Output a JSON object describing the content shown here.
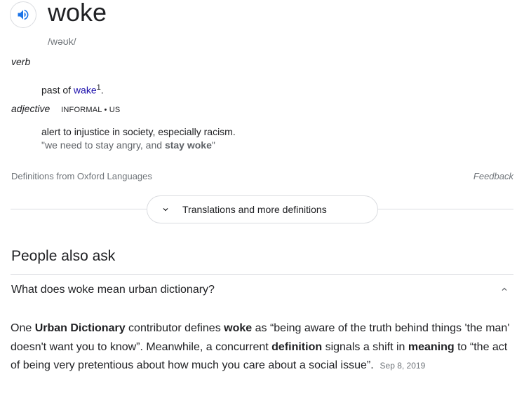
{
  "dictionary": {
    "word": "woke",
    "phonetic": "/wəʊk/",
    "senses": [
      {
        "pos": "verb",
        "definition_prefix": "past of ",
        "link_text": "wake",
        "superscript": "1",
        "definition_suffix": "."
      },
      {
        "pos": "adjective",
        "tag": "INFORMAL • US",
        "definition": "alert to injustice in society, especially racism.",
        "example_prefix": "\"we need to stay angry, and ",
        "example_bold": "stay woke",
        "example_suffix": "\""
      }
    ],
    "source": "Definitions from Oxford Languages",
    "feedback": "Feedback",
    "more_button": "Translations and more definitions"
  },
  "people_also_ask": {
    "title": "People also ask",
    "question": "What does woke mean urban dictionary?",
    "answer": {
      "p1": "One ",
      "b1": "Urban Dictionary",
      "p2": " contributor defines ",
      "b2": "woke",
      "p3": " as “being aware of the truth behind things 'the man' doesn't want you to know”. Meanwhile, a concurrent ",
      "b3": "definition",
      "p4": " signals a shift in ",
      "b4": "meaning",
      "p5": " to “the act of being very pretentious about how much you care about a social issue”.",
      "date": "Sep 8, 2019"
    }
  },
  "colors": {
    "link": "#1a0dab",
    "speaker_icon": "#1a73e8",
    "muted": "#70757a",
    "divider": "#dadce0"
  },
  "icons": {
    "speaker": "speaker-icon",
    "expand": "chevron-down-icon",
    "collapse": "chevron-up-icon"
  }
}
